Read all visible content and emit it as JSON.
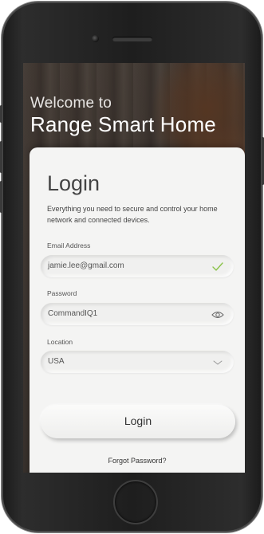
{
  "header": {
    "welcome": "Welcome to",
    "brand": "Range Smart Home"
  },
  "login": {
    "title": "Login",
    "subtitle": "Everything you need to secure and control your home network and connected devices.",
    "email": {
      "label": "Email Address",
      "value": "jamie.lee@gmail.com",
      "status_icon": "checkmark-icon",
      "status_color": "#8bc34a"
    },
    "password": {
      "label": "Password",
      "value": "CommandIQ1",
      "toggle_icon": "eye-icon"
    },
    "location": {
      "label": "Location",
      "value": "USA",
      "dropdown_icon": "chevron-down-icon"
    },
    "submit_label": "Login",
    "forgot_label": "Forgot Password?"
  }
}
